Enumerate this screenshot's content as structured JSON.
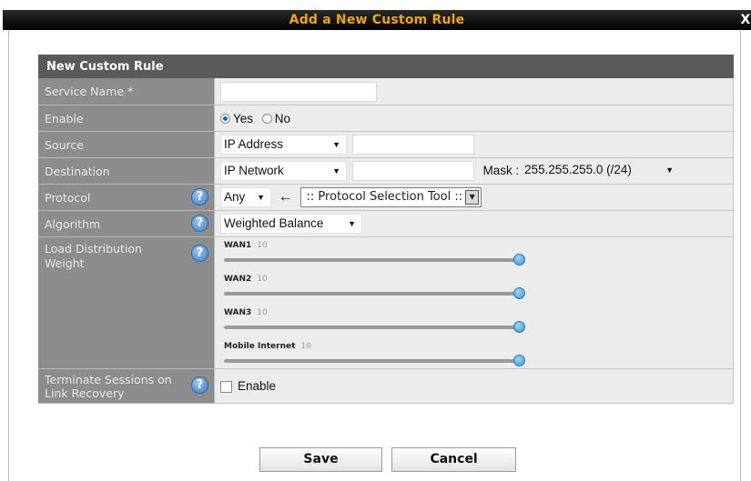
{
  "dialog": {
    "title": "Add a New Custom Rule",
    "close_label": "X"
  },
  "form": {
    "header": "New Custom Rule",
    "service_name": {
      "label": "Service Name *",
      "value": ""
    },
    "enable": {
      "label": "Enable",
      "yes": "Yes",
      "no": "No",
      "selected": "Yes"
    },
    "source": {
      "label": "Source",
      "type": "IP Address",
      "value": ""
    },
    "destination": {
      "label": "Destination",
      "type": "IP Network",
      "value": "",
      "mask_label": "Mask :",
      "mask_value": "255.255.255.0 (/24)"
    },
    "protocol": {
      "label": "Protocol",
      "value": "Any",
      "tool": ":: Protocol Selection Tool ::"
    },
    "algorithm": {
      "label": "Algorithm",
      "value": "Weighted Balance"
    },
    "load_distribution": {
      "label": "Load Distribution Weight",
      "sliders": [
        {
          "name": "WAN1",
          "value": "10",
          "level": 1.0
        },
        {
          "name": "WAN2",
          "value": "10",
          "level": 1.0
        },
        {
          "name": "WAN3",
          "value": "10",
          "level": 1.0
        },
        {
          "name": "Mobile Internet",
          "value": "10",
          "level": 1.0
        }
      ]
    },
    "terminate": {
      "label": "Terminate Sessions on Link Recovery",
      "option": "Enable",
      "checked": false
    }
  },
  "buttons": {
    "save": "Save",
    "cancel": "Cancel"
  }
}
